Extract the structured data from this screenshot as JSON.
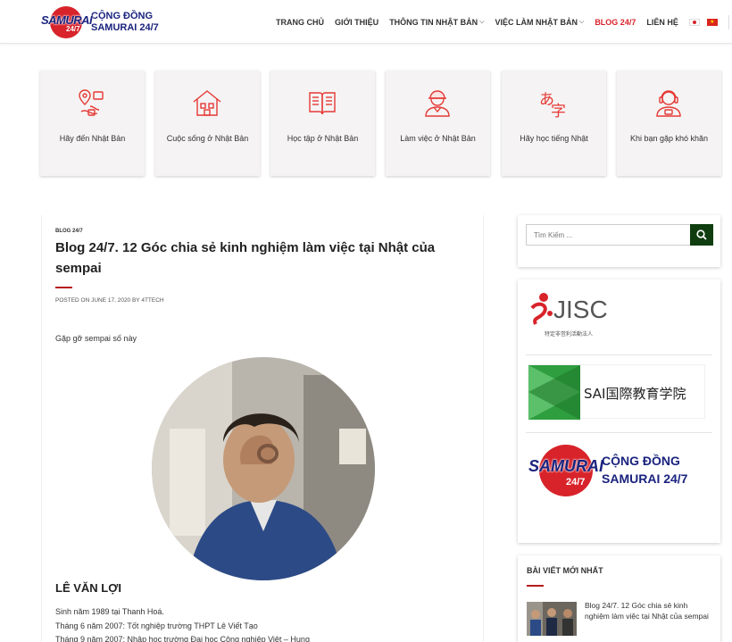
{
  "header": {
    "logo": {
      "word": "SAMURAI",
      "num": "24/7",
      "line1": "CỘNG ĐỒNG",
      "line2": "SAMURAI 24/7"
    },
    "nav": [
      {
        "label": "TRANG CHỦ",
        "dropdown": false,
        "active": false
      },
      {
        "label": "GIỚI THIỆU",
        "dropdown": false,
        "active": false
      },
      {
        "label": "THÔNG TIN NHẬT BẢN",
        "dropdown": true,
        "active": false
      },
      {
        "label": "VIỆC LÀM NHẬT BẢN",
        "dropdown": true,
        "active": false
      },
      {
        "label": "BLOG 24/7",
        "dropdown": false,
        "active": true
      },
      {
        "label": "LIÊN HỆ",
        "dropdown": false,
        "active": false
      }
    ],
    "caret": "⌵",
    "flag_vn_star": "★"
  },
  "categories": [
    {
      "label": "Hãy đến Nhật Bản",
      "icon": "map-pin-icon"
    },
    {
      "label": "Cuộc sống ở Nhật Bản",
      "icon": "house-icon"
    },
    {
      "label": "Học tập ở Nhật Bản",
      "icon": "book-icon"
    },
    {
      "label": "Làm việc ở Nhật Bản",
      "icon": "worker-icon"
    },
    {
      "label": "Hãy học tiếng Nhật",
      "icon": "kana-icon"
    },
    {
      "label": "Khi bạn gặp khó khăn",
      "icon": "support-agent-icon"
    }
  ],
  "article": {
    "category": "BLOG 24/7",
    "title": "Blog 24/7. 12 Góc chia sẻ kinh nghiệm làm việc tại Nhật của sempai",
    "meta": "POSTED ON JUNE 17, 2020 BY 4TTECH",
    "intro": "Gặp gỡ sempai số này",
    "name": "LÊ VĂN LỢI",
    "bio": [
      "Sinh năm 1989 tại Thanh Hoá.",
      "Tháng 6 năm 2007: Tốt nghiệp trường THPT Lê Viết Tạo",
      "Tháng 9 năm 2007: Nhập học trường Đại học Công nghiệp Việt – Hung"
    ]
  },
  "sidebar": {
    "search_placeholder": "Tìm Kiếm ...",
    "logos": {
      "jisc": {
        "name": "JISC",
        "subtitle": "特定非営利活動法人"
      },
      "sai": {
        "name": "SAI国際教育学院"
      },
      "samurai": {
        "word": "SAMURAI",
        "num": "24/7",
        "line1": "CỘNG ĐỒNG",
        "line2": "SAMURAI 24/7"
      }
    },
    "recent": {
      "title": "BÀI VIẾT MỚI NHẤT",
      "items": [
        {
          "title": "Blog 24/7. 12 Góc chia sẻ kinh nghiệm làm việc tại Nhật của sempai"
        }
      ]
    }
  },
  "colors": {
    "brand_red": "#d8232a",
    "brand_navy": "#1a237e",
    "search_button": "#0f3d0f",
    "card_bg": "#f5f3f3"
  }
}
